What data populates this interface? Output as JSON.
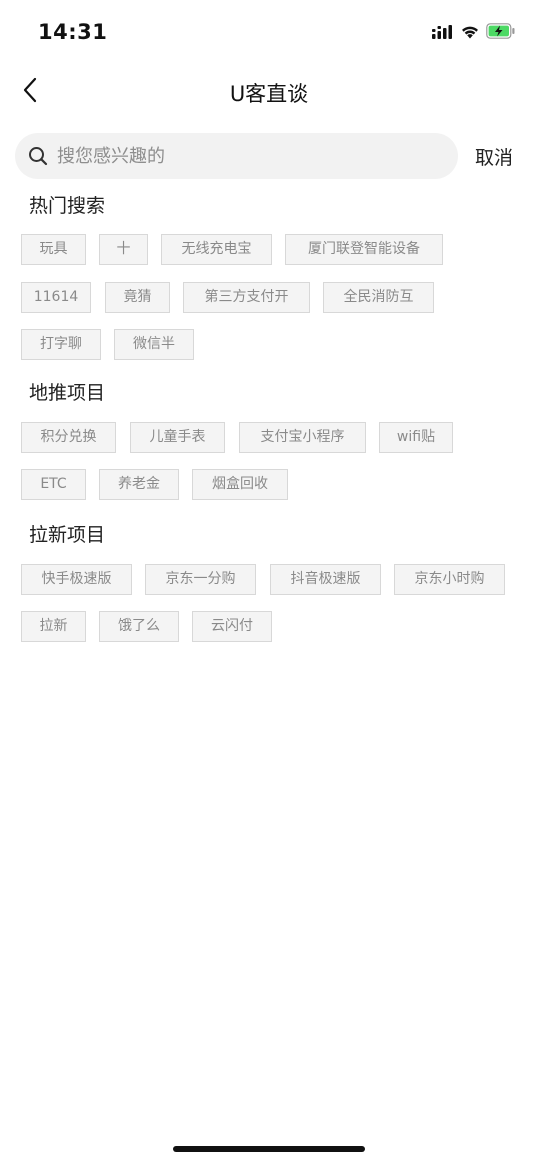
{
  "status_bar": {
    "time": "14:31",
    "icons": [
      "signal-icon",
      "wifi-icon",
      "battery-charging-icon"
    ]
  },
  "nav": {
    "back_icon": "chevron-left-icon",
    "title": "U客直谈"
  },
  "search": {
    "placeholder": "搜您感兴趣的",
    "value": "",
    "cancel_label": "取消"
  },
  "sections": {
    "hot": {
      "title": "热门搜索",
      "tags": [
        "玩具",
        "十",
        "无线充电宝",
        "厦门联登智能设备",
        "11614",
        "竟猜",
        "第三方支付开",
        "全民消防互",
        "打字聊",
        "微信半"
      ]
    },
    "ground": {
      "title": "地推项目",
      "tags": [
        "积分兑换",
        "儿童手表",
        "支付宝小程序",
        "wifi贴",
        "ETC",
        "养老金",
        "烟盒回收"
      ]
    },
    "newuser": {
      "title": "拉新项目",
      "tags": [
        "快手极速版",
        "京东一分购",
        "抖音极速版",
        "京东小时购",
        "拉新",
        "饿了么",
        "云闪付"
      ]
    }
  },
  "colors": {
    "tag_bg": "#f4f4f4",
    "tag_border": "#d8d8d8",
    "tag_text": "#8a8a8a",
    "search_bg": "#f2f2f2",
    "battery_charging": "#4cd964"
  }
}
